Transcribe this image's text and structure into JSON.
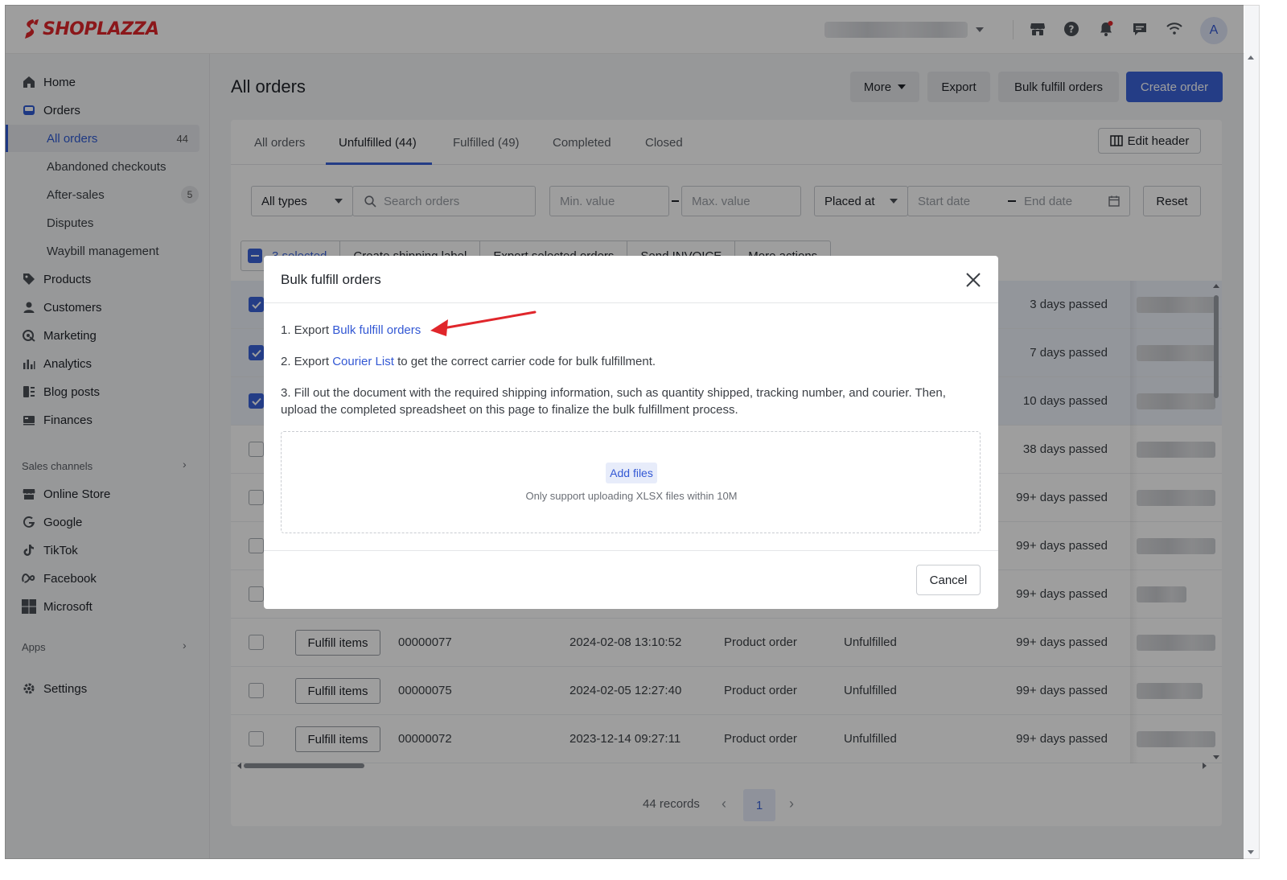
{
  "brand": {
    "name": "SHOPLAZZA",
    "color": "#e0262b"
  },
  "topbar": {
    "icons": [
      "storefront-icon",
      "help-icon",
      "bell-icon",
      "chat-icon",
      "wifi-icon"
    ],
    "avatar_initial": "A"
  },
  "sidebar": {
    "items": [
      {
        "label": "Home",
        "icon": "home-icon"
      },
      {
        "label": "Orders",
        "icon": "orders-icon"
      },
      {
        "label": "Products",
        "icon": "tag-icon"
      },
      {
        "label": "Customers",
        "icon": "person-icon"
      },
      {
        "label": "Marketing",
        "icon": "marketing-icon"
      },
      {
        "label": "Analytics",
        "icon": "analytics-icon"
      },
      {
        "label": "Blog posts",
        "icon": "blog-icon"
      },
      {
        "label": "Finances",
        "icon": "finance-icon"
      }
    ],
    "orders_sub": [
      {
        "label": "All orders",
        "count": "44"
      },
      {
        "label": "Abandoned checkouts"
      },
      {
        "label": "After-sales",
        "badge": "5"
      },
      {
        "label": "Disputes"
      },
      {
        "label": "Waybill management"
      }
    ],
    "sales_channels_label": "Sales channels",
    "channels": [
      {
        "label": "Online Store",
        "icon": "store-icon"
      },
      {
        "label": "Google",
        "icon": "google-icon"
      },
      {
        "label": "TikTok",
        "icon": "tiktok-icon"
      },
      {
        "label": "Facebook",
        "icon": "meta-icon"
      },
      {
        "label": "Microsoft",
        "icon": "microsoft-icon"
      }
    ],
    "apps_label": "Apps",
    "settings_label": "Settings"
  },
  "page": {
    "title": "All orders",
    "actions": {
      "more": "More",
      "export": "Export",
      "bulk_fulfill": "Bulk fulfill orders",
      "create": "Create order"
    }
  },
  "tabs": [
    "All orders",
    "Unfulfilled (44)",
    "Fulfilled (49)",
    "Completed",
    "Closed"
  ],
  "active_tab": "Unfulfilled (44)",
  "edit_header": "Edit header",
  "filters": {
    "type": "All types",
    "search_placeholder": "Search orders",
    "min_value": "Min. value",
    "max_value": "Max. value",
    "date_field": "Placed at",
    "start_date": "Start date",
    "end_date": "End date",
    "reset": "Reset"
  },
  "bulk_bar": [
    "3 selected",
    "Create shipping label",
    "Export selected orders",
    "Send INVOICE",
    "More actions"
  ],
  "rows": [
    {
      "checked": true,
      "passed": "3 days passed"
    },
    {
      "checked": true,
      "passed": "7 days passed"
    },
    {
      "checked": true,
      "passed": "10 days passed"
    },
    {
      "checked": false,
      "passed": "38 days passed"
    },
    {
      "checked": false,
      "passed": "99+ days passed"
    },
    {
      "checked": false,
      "passed": "99+ days passed"
    },
    {
      "checked": false,
      "passed": "99+ days passed"
    },
    {
      "checked": false,
      "fulfill": "Fulfill items",
      "order": "00000077",
      "date": "2024-02-08 13:10:52",
      "type": "Product order",
      "status": "Unfulfilled",
      "passed": "99+ days passed"
    },
    {
      "checked": false,
      "fulfill": "Fulfill items",
      "order": "00000075",
      "date": "2024-02-05 12:27:40",
      "type": "Product order",
      "status": "Unfulfilled",
      "passed": "99+ days passed"
    },
    {
      "checked": false,
      "fulfill": "Fulfill items",
      "order": "00000072",
      "date": "2023-12-14 09:27:11",
      "type": "Product order",
      "status": "Unfulfilled",
      "passed": "99+ days passed"
    }
  ],
  "pager": {
    "records": "44 records",
    "page": "1"
  },
  "modal": {
    "title": "Bulk fulfill orders",
    "step1_prefix": "1. Export ",
    "step1_link": "Bulk fulfill orders",
    "step2_prefix": "2. Export ",
    "step2_link": "Courier List",
    "step2_suffix": " to get the correct carrier code for bulk fulfillment.",
    "step3": "3. Fill out the document with the required shipping information, such as quantity shipped, tracking number, and courier. Then, upload the completed spreadsheet on this page to finalize the bulk fulfillment process.",
    "add_files": "Add files",
    "upload_hint": "Only support uploading XLSX files within 10M",
    "cancel": "Cancel"
  },
  "colors": {
    "primary": "#3b63d8",
    "annotation": "#e0262b"
  }
}
